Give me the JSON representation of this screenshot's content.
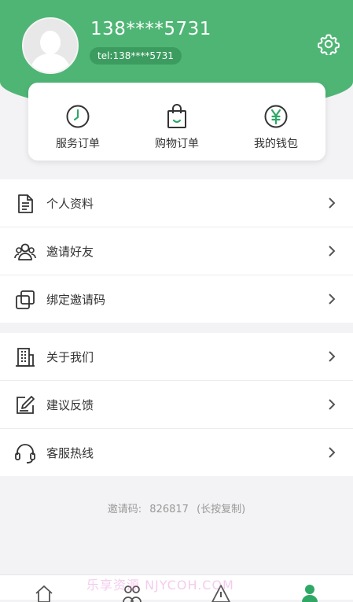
{
  "profile": {
    "phone": "138****5731",
    "tel_badge": "tel:138****5731"
  },
  "quick_actions": [
    {
      "label": "服务订单",
      "icon": "clock-icon"
    },
    {
      "label": "购物订单",
      "icon": "shopping-bag-icon"
    },
    {
      "label": "我的钱包",
      "icon": "yen-icon"
    }
  ],
  "menu_group_1": [
    {
      "label": "个人资料",
      "icon": "document-icon"
    },
    {
      "label": "邀请好友",
      "icon": "people-icon"
    },
    {
      "label": "绑定邀请码",
      "icon": "copy-icon"
    }
  ],
  "menu_group_2": [
    {
      "label": "关于我们",
      "icon": "building-icon"
    },
    {
      "label": "建议反馈",
      "icon": "edit-icon"
    },
    {
      "label": "客服热线",
      "icon": "headset-icon"
    }
  ],
  "invite": {
    "label": "邀请码:",
    "code": "826817",
    "hint": "(长按复制)"
  },
  "watermark": "乐享资源 NJYCOH.COM",
  "colors": {
    "brand": "#4fb575",
    "badge": "#3c9c60",
    "icon_dark": "#333333",
    "icon_green": "#2fa866"
  },
  "tabbar": [
    {
      "icon": "home-icon"
    },
    {
      "icon": "community-icon"
    },
    {
      "icon": "alert-icon"
    },
    {
      "icon": "user-icon",
      "active": true
    }
  ]
}
